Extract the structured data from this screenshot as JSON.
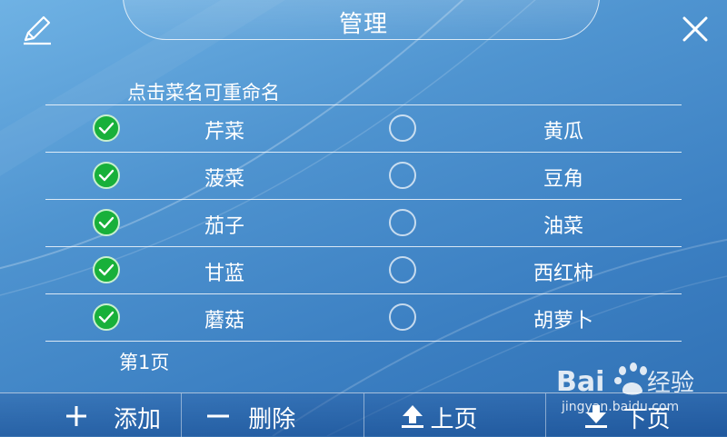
{
  "header": {
    "title": "管理"
  },
  "hint": "点击菜名可重命名",
  "dishes": [
    {
      "left": {
        "name": "芹菜",
        "checked": true
      },
      "right": {
        "name": "黄瓜",
        "checked": false
      }
    },
    {
      "left": {
        "name": "菠菜",
        "checked": true
      },
      "right": {
        "name": "豆角",
        "checked": false
      }
    },
    {
      "left": {
        "name": "茄子",
        "checked": true
      },
      "right": {
        "name": "油菜",
        "checked": false
      }
    },
    {
      "left": {
        "name": "甘蓝",
        "checked": true
      },
      "right": {
        "name": "西红柿",
        "checked": false
      }
    },
    {
      "left": {
        "name": "蘑菇",
        "checked": true
      },
      "right": {
        "name": "胡萝卜",
        "checked": false
      }
    }
  ],
  "page_label": "第1页",
  "toolbar": {
    "add_label": "添加",
    "delete_label": "删除",
    "prev_label": "上页",
    "next_label": "下页"
  },
  "watermark": {
    "brand": "Bai",
    "brand2": "经验",
    "url": "jingyan.baidu.com"
  },
  "colors": {
    "check_green": "#18b03a",
    "background": "#4f94d0"
  },
  "icons": [
    "edit-icon",
    "close-icon",
    "plus-icon",
    "minus-icon",
    "upload-arrow-icon",
    "download-arrow-icon",
    "check-icon"
  ]
}
